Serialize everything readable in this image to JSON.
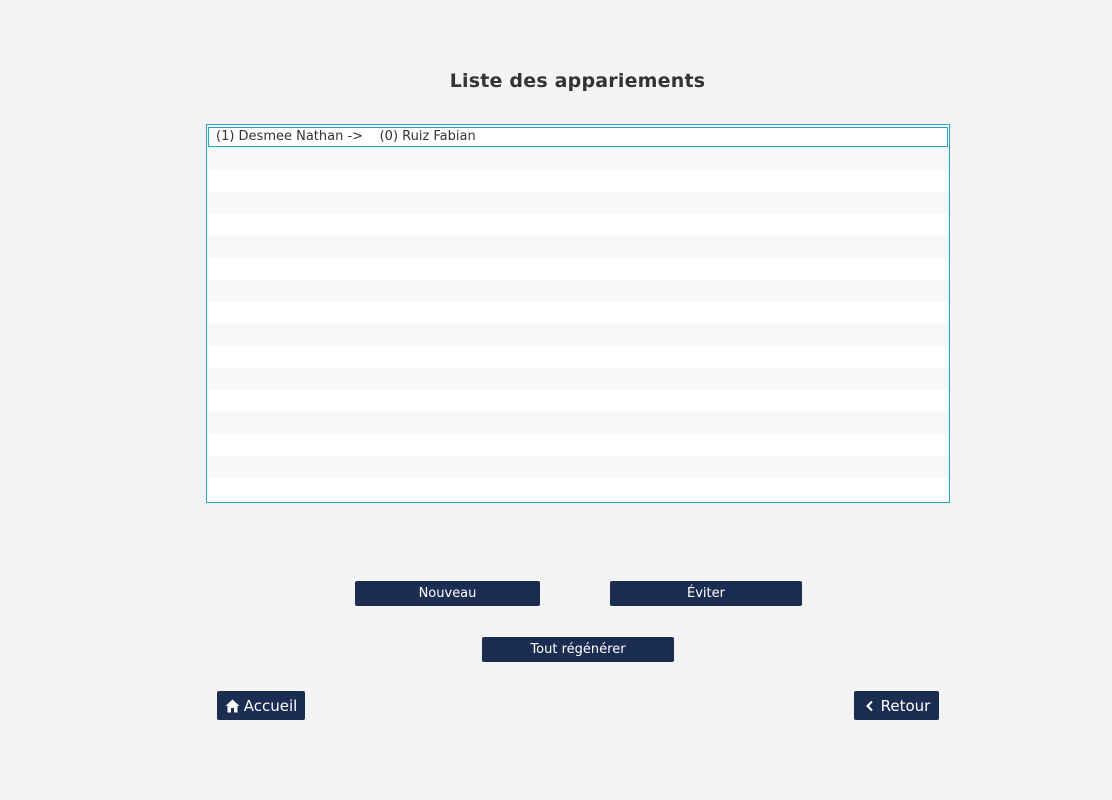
{
  "page": {
    "title": "Liste des appariements"
  },
  "pairings": {
    "items": [
      "(1) Desmee Nathan ->    (0) Ruiz Fabian"
    ]
  },
  "actions": {
    "new_label": "Nouveau",
    "avoid_label": "Éviter",
    "regenerate_label": "Tout régénérer"
  },
  "nav": {
    "home_label": "Accueil",
    "home_icon": "home-icon",
    "back_label": "Retour",
    "back_icon": "chevron-left-icon"
  },
  "colors": {
    "button_bg": "#1b2d52",
    "list_border": "#2aa3c9",
    "background": "#f4f4f4"
  }
}
